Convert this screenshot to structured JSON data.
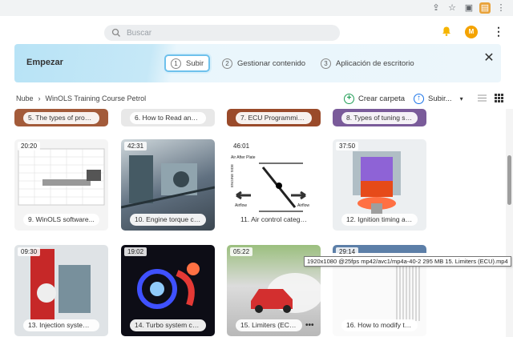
{
  "search": {
    "placeholder": "Buscar"
  },
  "user": {
    "avatar_initial": "M"
  },
  "banner": {
    "title": "Empezar",
    "steps": [
      {
        "num": "1",
        "label": "Subir"
      },
      {
        "num": "2",
        "label": "Gestionar contenido"
      },
      {
        "num": "3",
        "label": "Aplicación de escritorio"
      }
    ]
  },
  "breadcrumb": {
    "root": "Nube",
    "sep": "›",
    "current": "WinOLS Training Course Petrol"
  },
  "toolbar": {
    "create_folder": "Crear carpeta",
    "upload": "Subir..."
  },
  "videos_top": [
    {
      "title": "5. The types of progra..."
    },
    {
      "title": "6. How to Read and ..."
    },
    {
      "title": "7. ECU Programming ..."
    },
    {
      "title": "8. Types of tuning so..."
    }
  ],
  "videos": [
    {
      "duration": "20:20",
      "title": "9. WinOLS software..."
    },
    {
      "duration": "42:31",
      "title": "10. Engine torque cat..."
    },
    {
      "duration": "46:01",
      "title": "11. Air control catego..."
    },
    {
      "duration": "37:50",
      "title": "12. Ignition timing an..."
    },
    {
      "duration": "09:30",
      "title": "13. Injection system a..."
    },
    {
      "duration": "19:02",
      "title": "14. Turbo system cate..."
    },
    {
      "duration": "05:22",
      "title": "15. Limiters (ECU).mp4"
    },
    {
      "duration": "29:14",
      "title": "16. How to modify th..."
    }
  ],
  "diagram_labels": {
    "a": "Air After Plate",
    "b": "ENGINE SIDE",
    "c": "Airflow",
    "d": "Airflow"
  },
  "tooltip": "1920x1080 @25fps mp42/avc1/mp4a-40-2 295 MB 15. Limiters (ECU).mp4",
  "colors": {
    "accent": "#1f9d55",
    "upload_blue": "#1a73e8",
    "banner": "#c6e8f7"
  }
}
